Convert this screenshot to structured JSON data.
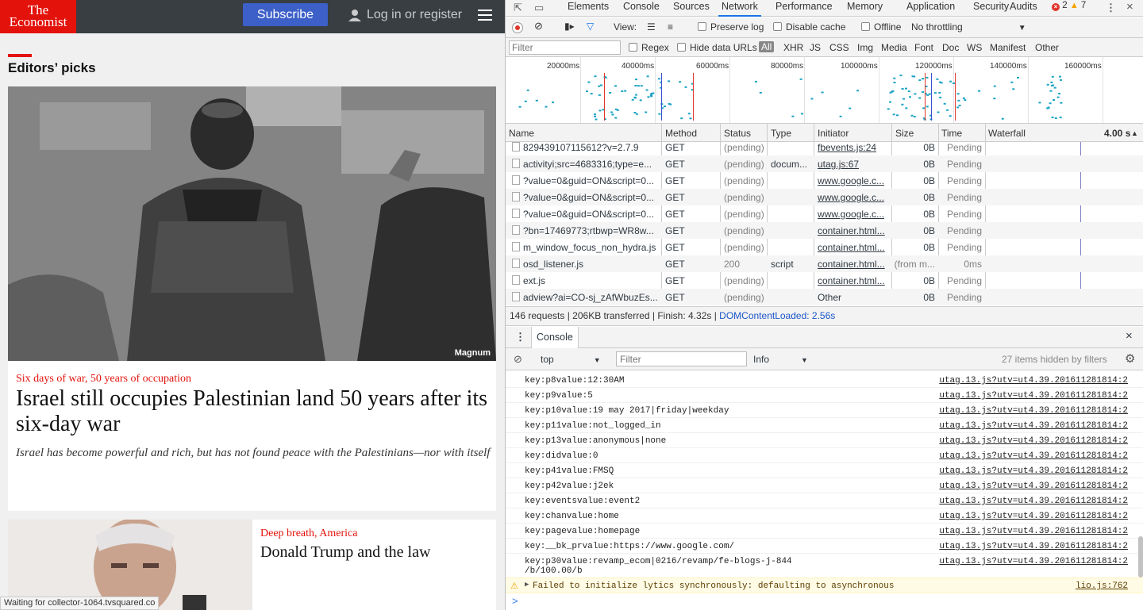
{
  "economist": {
    "logo_line1": "The",
    "logo_line2": "Economist",
    "subscribe_label": "Subscribe",
    "login_label": "Log in or register",
    "section_title": "Editors’ picks",
    "hero": {
      "image_credit": "Magnum",
      "flytitle": "Six days of war, 50 years of occupation",
      "headline": "Israel still occupies Palestinian land 50 years after its six-day war",
      "rubric": "Israel has become powerful and rich, but has not found peace with the Palestinians—nor with itself"
    },
    "card2": {
      "flytitle": "Deep breath, America",
      "headline": "Donald Trump and the law"
    },
    "status_text": "Waiting for collector-1064.tvsquared.co"
  },
  "devtools": {
    "tabs": [
      "Elements",
      "Console",
      "Sources",
      "Network",
      "Performance",
      "Memory",
      "Application",
      "Security",
      "Audits"
    ],
    "active_tab": "Network",
    "error_count": "2",
    "warning_count": "7",
    "toolbar": {
      "view_label": "View:",
      "preserve_log": "Preserve log",
      "disable_cache": "Disable cache",
      "offline": "Offline",
      "throttling": "No throttling"
    },
    "filter": {
      "placeholder": "Filter",
      "regex": "Regex",
      "hide_data_urls": "Hide data URLs",
      "types": [
        "All",
        "XHR",
        "JS",
        "CSS",
        "Img",
        "Media",
        "Font",
        "Doc",
        "WS",
        "Manifest",
        "Other"
      ]
    },
    "overview_ticks": [
      "20000ms",
      "40000ms",
      "60000ms",
      "80000ms",
      "100000ms",
      "120000ms",
      "140000ms",
      "160000ms"
    ],
    "columns": [
      "Name",
      "Method",
      "Status",
      "Type",
      "Initiator",
      "Size",
      "Time",
      "Waterfall"
    ],
    "waterfall_scale": "4.00 s",
    "requests": [
      {
        "name": "829439107115612?v=2.7.9",
        "method": "GET",
        "status": "(pending)",
        "type": "",
        "initiator": "fbevents.js:24",
        "size": "0B",
        "time": "Pending"
      },
      {
        "name": "activityi;src=4683316;type=e...",
        "method": "GET",
        "status": "(pending)",
        "type": "docum...",
        "initiator": "utag.js:67",
        "size": "0B",
        "time": "Pending"
      },
      {
        "name": "?value=0&guid=ON&script=0...",
        "method": "GET",
        "status": "(pending)",
        "type": "",
        "initiator": "www.google.c...",
        "size": "0B",
        "time": "Pending"
      },
      {
        "name": "?value=0&guid=ON&script=0...",
        "method": "GET",
        "status": "(pending)",
        "type": "",
        "initiator": "www.google.c...",
        "size": "0B",
        "time": "Pending"
      },
      {
        "name": "?value=0&guid=ON&script=0...",
        "method": "GET",
        "status": "(pending)",
        "type": "",
        "initiator": "www.google.c...",
        "size": "0B",
        "time": "Pending"
      },
      {
        "name": "?bn=17469773;rtbwp=WR8w...",
        "method": "GET",
        "status": "(pending)",
        "type": "",
        "initiator": "container.html...",
        "size": "0B",
        "time": "Pending"
      },
      {
        "name": "m_window_focus_non_hydra.js",
        "method": "GET",
        "status": "(pending)",
        "type": "",
        "initiator": "container.html...",
        "size": "0B",
        "time": "Pending"
      },
      {
        "name": "osd_listener.js",
        "method": "GET",
        "status": "200",
        "type": "script",
        "initiator": "container.html...",
        "size": "(from m...",
        "time": "0ms"
      },
      {
        "name": "ext.js",
        "method": "GET",
        "status": "(pending)",
        "type": "",
        "initiator": "container.html...",
        "size": "0B",
        "time": "Pending"
      },
      {
        "name": "adview?ai=CO-sj_zAfWbuzEs...",
        "method": "GET",
        "status": "(pending)",
        "type": "",
        "initiator": "Other",
        "size": "0B",
        "time": "Pending"
      }
    ],
    "summary": {
      "main": "146 requests | 206KB transferred | Finish: 4.32s | ",
      "dcl": "DOMContentLoaded: 2.56s"
    },
    "console": {
      "tab_label": "Console",
      "context": "top",
      "filter_placeholder": "Filter",
      "level": "Info",
      "hidden_note": "27 items hidden by filters",
      "logs": [
        {
          "msg": "key:p8value:12:30AM",
          "src": "utag.13.js?utv=ut4.39.201611281814:2"
        },
        {
          "msg": "key:p9value:5",
          "src": "utag.13.js?utv=ut4.39.201611281814:2"
        },
        {
          "msg": "key:p10value:19 may 2017|friday|weekday",
          "src": "utag.13.js?utv=ut4.39.201611281814:2"
        },
        {
          "msg": "key:p11value:not_logged_in",
          "src": "utag.13.js?utv=ut4.39.201611281814:2"
        },
        {
          "msg": "key:p13value:anonymous|none",
          "src": "utag.13.js?utv=ut4.39.201611281814:2"
        },
        {
          "msg": "key:didvalue:0",
          "src": "utag.13.js?utv=ut4.39.201611281814:2"
        },
        {
          "msg": "key:p41value:FMSQ",
          "src": "utag.13.js?utv=ut4.39.201611281814:2"
        },
        {
          "msg": "key:p42value:j2ek",
          "src": "utag.13.js?utv=ut4.39.201611281814:2"
        },
        {
          "msg": "key:eventsvalue:event2",
          "src": "utag.13.js?utv=ut4.39.201611281814:2"
        },
        {
          "msg": "key:chanvalue:home",
          "src": "utag.13.js?utv=ut4.39.201611281814:2"
        },
        {
          "msg": "key:pagevalue:homepage",
          "src": "utag.13.js?utv=ut4.39.201611281814:2"
        },
        {
          "msg": "key:__bk_prvalue:https://www.google.com/",
          "src": "utag.13.js?utv=ut4.39.201611281814:2"
        },
        {
          "msg": "key:p30value:revamp_ecom|0216/revamp/fe-blogs-j-844\n/b/100.00/b",
          "src": "utag.13.js?utv=ut4.39.201611281814:2"
        }
      ],
      "warning": {
        "msg": "Failed to initialize lytics synchronously: defaulting to asynchronous",
        "src": "lio.js:762"
      },
      "prompt": ">"
    },
    "colors": {
      "accent": "#1a73e8",
      "error": "#e0352b",
      "warning": "#f4a300",
      "economist_red": "#e3120b",
      "subscribe_blue": "#3c5fc8"
    }
  }
}
